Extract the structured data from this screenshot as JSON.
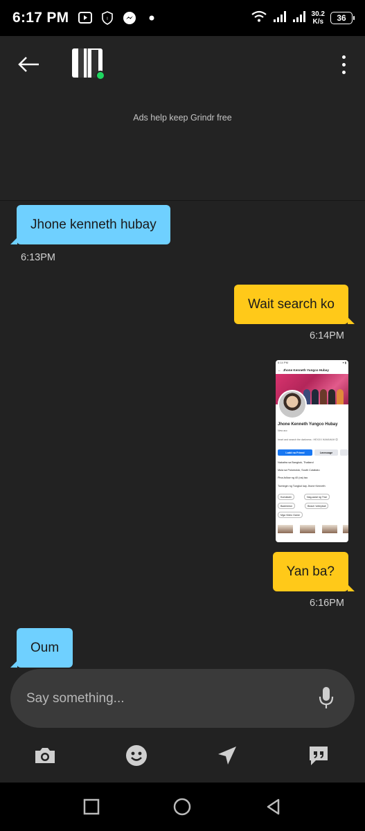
{
  "status_bar": {
    "time": "6:17 PM",
    "net_speed_value": "30.2",
    "net_speed_unit": "K/s",
    "battery": "36",
    "icons": [
      "video-app-icon",
      "shield-notification-icon",
      "messenger-icon",
      "dot-icon",
      "wifi-icon",
      "signal-icon",
      "signal-icon"
    ]
  },
  "header": {
    "back_icon": "arrow-left-icon",
    "avatar": "profile-avatar",
    "online": true,
    "more_icon": "more-vert-icon",
    "ads_text": "Ads help keep Grindr free"
  },
  "messages": [
    {
      "direction": "in",
      "text": "Jhone kenneth hubay",
      "time": "6:13PM"
    },
    {
      "direction": "out",
      "text": "Wait search ko",
      "time": "6:14PM"
    },
    {
      "direction": "out",
      "type": "image",
      "image": {
        "status_time": "6:14 PM",
        "profile_title": "Jhone Kenneth Yungco Hubay",
        "name": "Jhone Kenneth Yungco Hubay",
        "sub": "New acc",
        "bio": "heart and search the darkness : HEXXX HAHAHAH 😊",
        "add_friend": "I-add na Friend",
        "message": "I-message",
        "info": [
          "Nakatira sa Bangkok, Thailand",
          "Mula sa Polomolok, South Cotabato",
          "Pina-follow ng 40 (na) tao",
          "Tumingin ng Tungkol kay Jhone Kenneth"
        ],
        "chips": [
          "Kumakain",
          "Nag-aaral ng Thai",
          "Badminton",
          "Beach Volleyball",
          "Mga Video Game"
        ]
      },
      "time": ""
    },
    {
      "direction": "out",
      "text": "Yan ba?",
      "time": "6:16PM"
    },
    {
      "direction": "in",
      "text": "Oum",
      "time": ""
    }
  ],
  "composer": {
    "placeholder": "Say something...",
    "mic_icon": "microphone-icon"
  },
  "actions": [
    "camera-icon",
    "emoji-icon",
    "location-icon",
    "saved-phrases-icon"
  ],
  "nav": [
    "recents-square-icon",
    "home-circle-icon",
    "back-triangle-icon"
  ]
}
